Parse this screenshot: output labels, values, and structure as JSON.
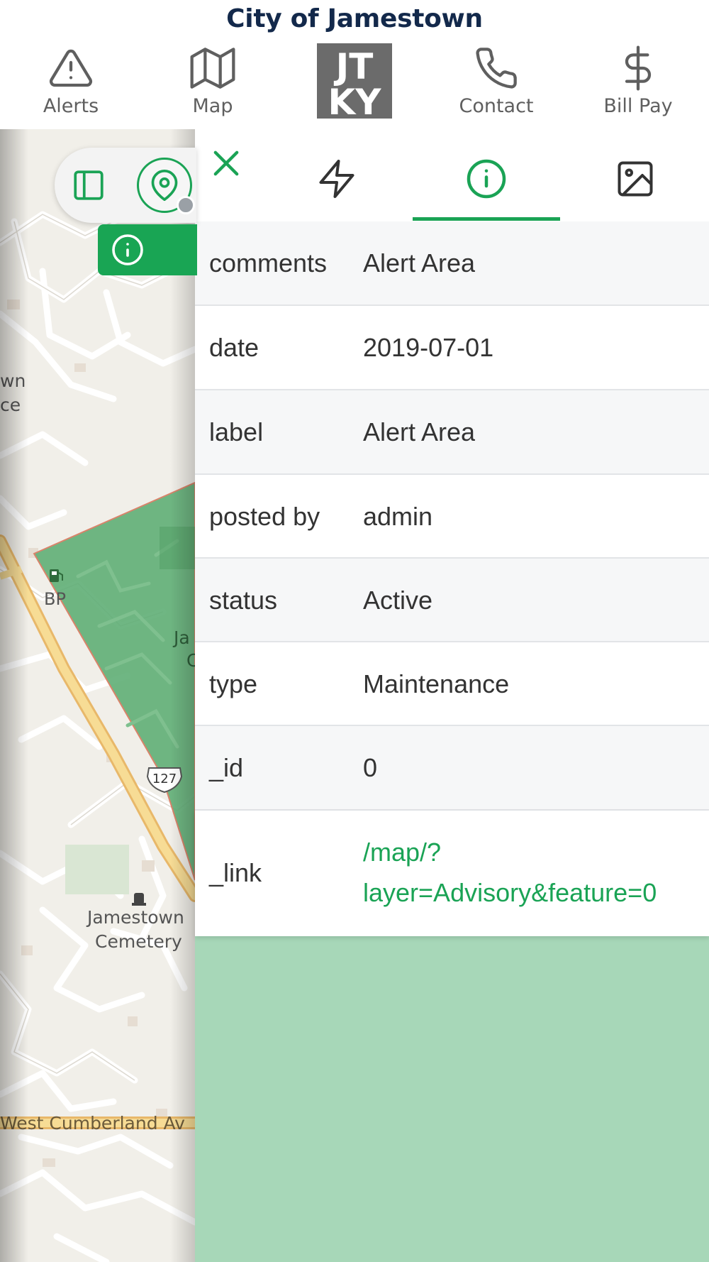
{
  "header": {
    "title": "City of Jamestown",
    "nav": [
      {
        "label": "Alerts",
        "icon": "alert-triangle-icon"
      },
      {
        "label": "Map",
        "icon": "map-icon"
      },
      {
        "label": "Contact",
        "icon": "phone-icon"
      },
      {
        "label": "Bill Pay",
        "icon": "dollar-icon"
      }
    ],
    "logo": {
      "line1": "JT",
      "line2": "KY"
    }
  },
  "map": {
    "labels": {
      "bp": "BP",
      "town_fragment_1": "wn",
      "town_fragment_2": "ce",
      "highway": "127",
      "cemetery_line1": "Jamestown",
      "cemetery_line2": "Cemetery",
      "street": "West Cumberland Av",
      "park_fragment_1": "Ja",
      "park_fragment_2": "C"
    },
    "colors": {
      "alert_area": "#5fae75",
      "alert_border": "#d9836a",
      "road_main": "#f5d58a",
      "background": "#f1efe9"
    }
  },
  "panel": {
    "tabs": [
      {
        "name": "actions",
        "icon": "lightning-icon"
      },
      {
        "name": "info",
        "icon": "info-icon",
        "active": true
      },
      {
        "name": "image",
        "icon": "image-icon"
      }
    ],
    "attributes": [
      {
        "key": "comments",
        "value": "Alert Area"
      },
      {
        "key": "date",
        "value": "2019-07-01"
      },
      {
        "key": "label",
        "value": "Alert Area"
      },
      {
        "key": "posted by",
        "value": "admin"
      },
      {
        "key": "status",
        "value": "Active"
      },
      {
        "key": "type",
        "value": "Maintenance"
      },
      {
        "key": "_id",
        "value": "0"
      },
      {
        "key": "_link",
        "value_line1": "/map/?",
        "value_line2": "layer=Advisory&feature=0"
      }
    ],
    "accent_color": "#1aa355"
  }
}
